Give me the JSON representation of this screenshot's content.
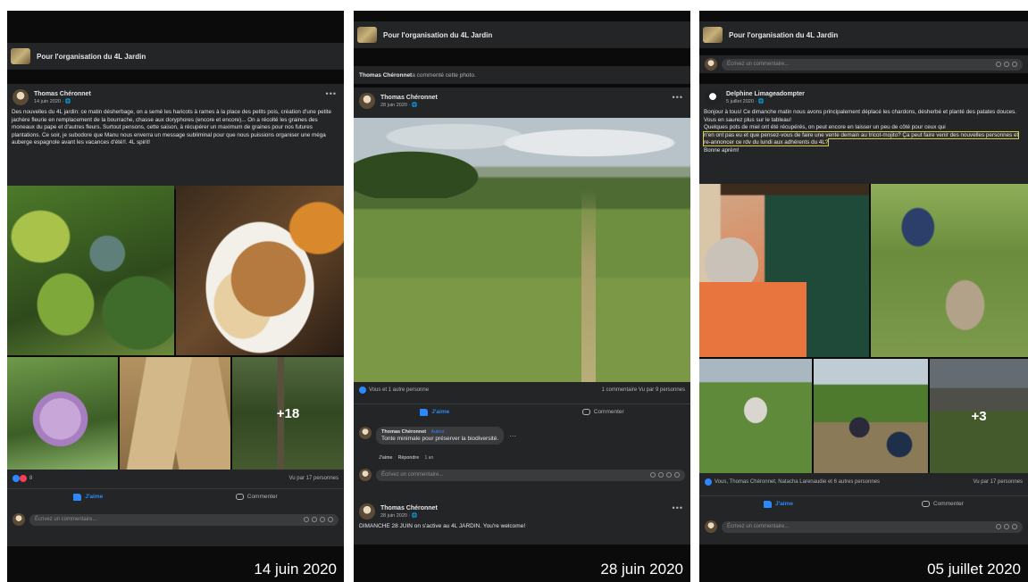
{
  "group_name": "Pour l'organisation du 4L Jardin",
  "comment_placeholder": "Écrivez un commentaire...",
  "actions": {
    "like": "J'aime",
    "comment": "Commenter"
  },
  "screens": [
    {
      "date_caption": "14 juin 2020",
      "post": {
        "author": "Thomas Chéronnet",
        "meta": "14 juin 2020 · 🌐",
        "text": "Des nouvelles du 4L jardin: ce matin désherbage, on a semé les haricots à rames à la place des petits pois, création d'une petite jachère fleurie en remplacement de la bourrache, chasse aux doryphores (encore et encore)... On a récolté les graines des moneaux du pape et d'autres fleurs. Surtout pensons, cette saison, à récupérer un maximum de graines pour nos futures plantations. Ce soir, je subodore que Manu nous enverra un message subliminal pour que nous puissions organiser une méga auberge espagnole avant les vacances d'été!!. 4L spirit!",
        "more_photos": "+18",
        "reaction_count": "8",
        "views": "Vu par 17 personnes"
      }
    },
    {
      "date_caption": "28 juin 2020",
      "notice_author": "Thomas Chéronnet",
      "notice_text": " a commenté cette photo.",
      "post": {
        "author": "Thomas Chéronnet",
        "meta": "28 juin 2020 · 🌐",
        "reactions_text": "Vous et 1 autre personne",
        "stats_right": "1 commentaire  Vu par 9 personnes"
      },
      "comment": {
        "author": "Thomas Chéronnet",
        "badge": "Auteur",
        "text": "Tonte minimale pour préserver la biodiversité.",
        "like": "J'aime",
        "reply": "Répondre",
        "age": "1 an"
      },
      "second_post": {
        "author": "Thomas Chéronnet",
        "meta": "28 juin 2020 · 🌐",
        "text": "DIMANCHE 28 JUIN on s'active au 4L JARDIN. You're welcome!"
      }
    },
    {
      "date_caption": "05 juillet 2020",
      "post": {
        "author": "Delphine Limageadompter",
        "meta": "5 juillet 2020 · 🌐",
        "text_a": "Bonjour à tous! Ce dimanche matin nous avons principalement déplacé les chardons, désherbé et planté des patates douces. Vous en saurez plus sur le tableau!",
        "text_b": "Quelques pots de miel ont été récupérés, on peut encore en laisser un peu de côté pour ceux qui",
        "text_hl": "n'en ont pas eu et que pensez-vous de faire une vente demain au tricot-mojito? Ça peut faire venir des nouvelles personnes et re-annoncer ce rdv du lundi aux adhérents du 4L?",
        "text_c": "Bonne aprèm!",
        "more_photos": "+3",
        "reactions_text": "Vous, Thomas Chéronnet, Natacha Larenaudie et 6 autres personnes",
        "views": "Vu par 17 personnes"
      }
    }
  ]
}
